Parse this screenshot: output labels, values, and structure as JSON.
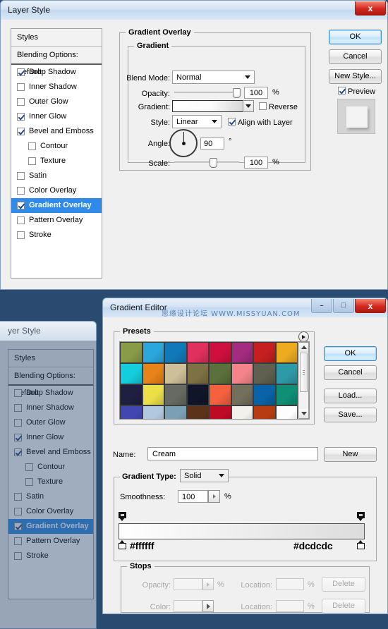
{
  "layer_style": {
    "title": "Layer Style",
    "close_label": "x",
    "styles_panel": {
      "header": "Styles",
      "blending_options": "Blending Options: Default",
      "items": [
        {
          "label": "Drop Shadow",
          "checked": true,
          "indent": false,
          "selected": false
        },
        {
          "label": "Inner Shadow",
          "checked": false,
          "indent": false,
          "selected": false
        },
        {
          "label": "Outer Glow",
          "checked": false,
          "indent": false,
          "selected": false
        },
        {
          "label": "Inner Glow",
          "checked": true,
          "indent": false,
          "selected": false
        },
        {
          "label": "Bevel and Emboss",
          "checked": true,
          "indent": false,
          "selected": false
        },
        {
          "label": "Contour",
          "checked": false,
          "indent": true,
          "selected": false
        },
        {
          "label": "Texture",
          "checked": false,
          "indent": true,
          "selected": false
        },
        {
          "label": "Satin",
          "checked": false,
          "indent": false,
          "selected": false
        },
        {
          "label": "Color Overlay",
          "checked": false,
          "indent": false,
          "selected": false
        },
        {
          "label": "Gradient Overlay",
          "checked": true,
          "indent": false,
          "selected": true
        },
        {
          "label": "Pattern Overlay",
          "checked": false,
          "indent": false,
          "selected": false
        },
        {
          "label": "Stroke",
          "checked": false,
          "indent": false,
          "selected": false
        }
      ]
    },
    "section_title": "Gradient Overlay",
    "group_title": "Gradient",
    "fields": {
      "blend_mode_label": "Blend Mode:",
      "blend_mode_value": "Normal",
      "opacity_label": "Opacity:",
      "opacity_value": "100",
      "opacity_unit": "%",
      "gradient_label": "Gradient:",
      "reverse_label": "Reverse",
      "reverse_checked": false,
      "style_label": "Style:",
      "style_value": "Linear",
      "align_label": "Align with Layer",
      "align_checked": true,
      "angle_label": "Angle:",
      "angle_value": "90",
      "angle_unit": "°",
      "scale_label": "Scale:",
      "scale_value": "100",
      "scale_unit": "%"
    },
    "buttons": {
      "ok": "OK",
      "cancel": "Cancel",
      "new_style": "New Style...",
      "preview_label": "Preview",
      "preview_checked": true
    }
  },
  "layer_style_back": {
    "title": "yer Style",
    "styles_panel": {
      "header": "Styles",
      "blending_options": "Blending Options: Default",
      "items": [
        {
          "label": "Drop Shadow",
          "checked": false,
          "indent": false,
          "selected": false
        },
        {
          "label": "Inner Shadow",
          "checked": false,
          "indent": false,
          "selected": false
        },
        {
          "label": "Outer Glow",
          "checked": false,
          "indent": false,
          "selected": false
        },
        {
          "label": "Inner Glow",
          "checked": true,
          "indent": false,
          "selected": false
        },
        {
          "label": "Bevel and Emboss",
          "checked": true,
          "indent": false,
          "selected": false
        },
        {
          "label": "Contour",
          "checked": false,
          "indent": true,
          "selected": false
        },
        {
          "label": "Texture",
          "checked": false,
          "indent": true,
          "selected": false
        },
        {
          "label": "Satin",
          "checked": false,
          "indent": false,
          "selected": false
        },
        {
          "label": "Color Overlay",
          "checked": false,
          "indent": false,
          "selected": false
        },
        {
          "label": "Gradient Overlay",
          "checked": true,
          "indent": false,
          "selected": true
        },
        {
          "label": "Pattern Overlay",
          "checked": false,
          "indent": false,
          "selected": false
        },
        {
          "label": "Stroke",
          "checked": false,
          "indent": false,
          "selected": false
        }
      ]
    }
  },
  "gradient_editor": {
    "title": "Gradient Editor",
    "watermark": "思缘设计论坛  WWW.MISSYUAN.COM",
    "window_buttons": {
      "minimize": "–",
      "maximize": "□",
      "close": "x"
    },
    "presets_label": "Presets",
    "buttons": {
      "ok": "OK",
      "cancel": "Cancel",
      "load": "Load...",
      "save": "Save...",
      "new": "New"
    },
    "name_label": "Name:",
    "name_value": "Cream",
    "gradient_type_label": "Gradient Type:",
    "gradient_type_value": "Solid",
    "smoothness_label": "Smoothness:",
    "smoothness_value": "100",
    "smoothness_unit": "%",
    "gradient_start_hex": "#ffffff",
    "gradient_end_hex": "#dcdcdc",
    "stops": {
      "title": "Stops",
      "opacity_label": "Opacity:",
      "opacity_value": "",
      "opacity_unit": "%",
      "opacity_location_label": "Location:",
      "opacity_location_value": "",
      "opacity_location_unit": "%",
      "opacity_delete": "Delete",
      "color_label": "Color:",
      "color_location_label": "Location:",
      "color_location_value": "",
      "color_location_unit": "%",
      "color_delete": "Delete"
    },
    "preset_swatches": [
      [
        "#8a9b48",
        "#2ca7dd",
        "#1279b8",
        "#e0305e",
        "#cf0f3e",
        "#a32b80",
        "#c51f1f",
        "#ecab20"
      ],
      [
        "#14cede",
        "#e8831a",
        "#cdbf97",
        "#7e7145",
        "#5b703a",
        "#f4838c",
        "#5f6050",
        "#2e9aa8"
      ],
      [
        "#1f1f42",
        "#ebe04a",
        "#666a62",
        "#101627",
        "#f4613e",
        "#726f5c",
        "#0a63a6",
        "#0f9076"
      ],
      [
        "#4246b0",
        "#b0c8e0",
        "#7b9fb5",
        "#5c3318",
        "#bf0a24",
        "#f2f1ec",
        "#b83c12",
        "#fdfdfd"
      ]
    ]
  }
}
